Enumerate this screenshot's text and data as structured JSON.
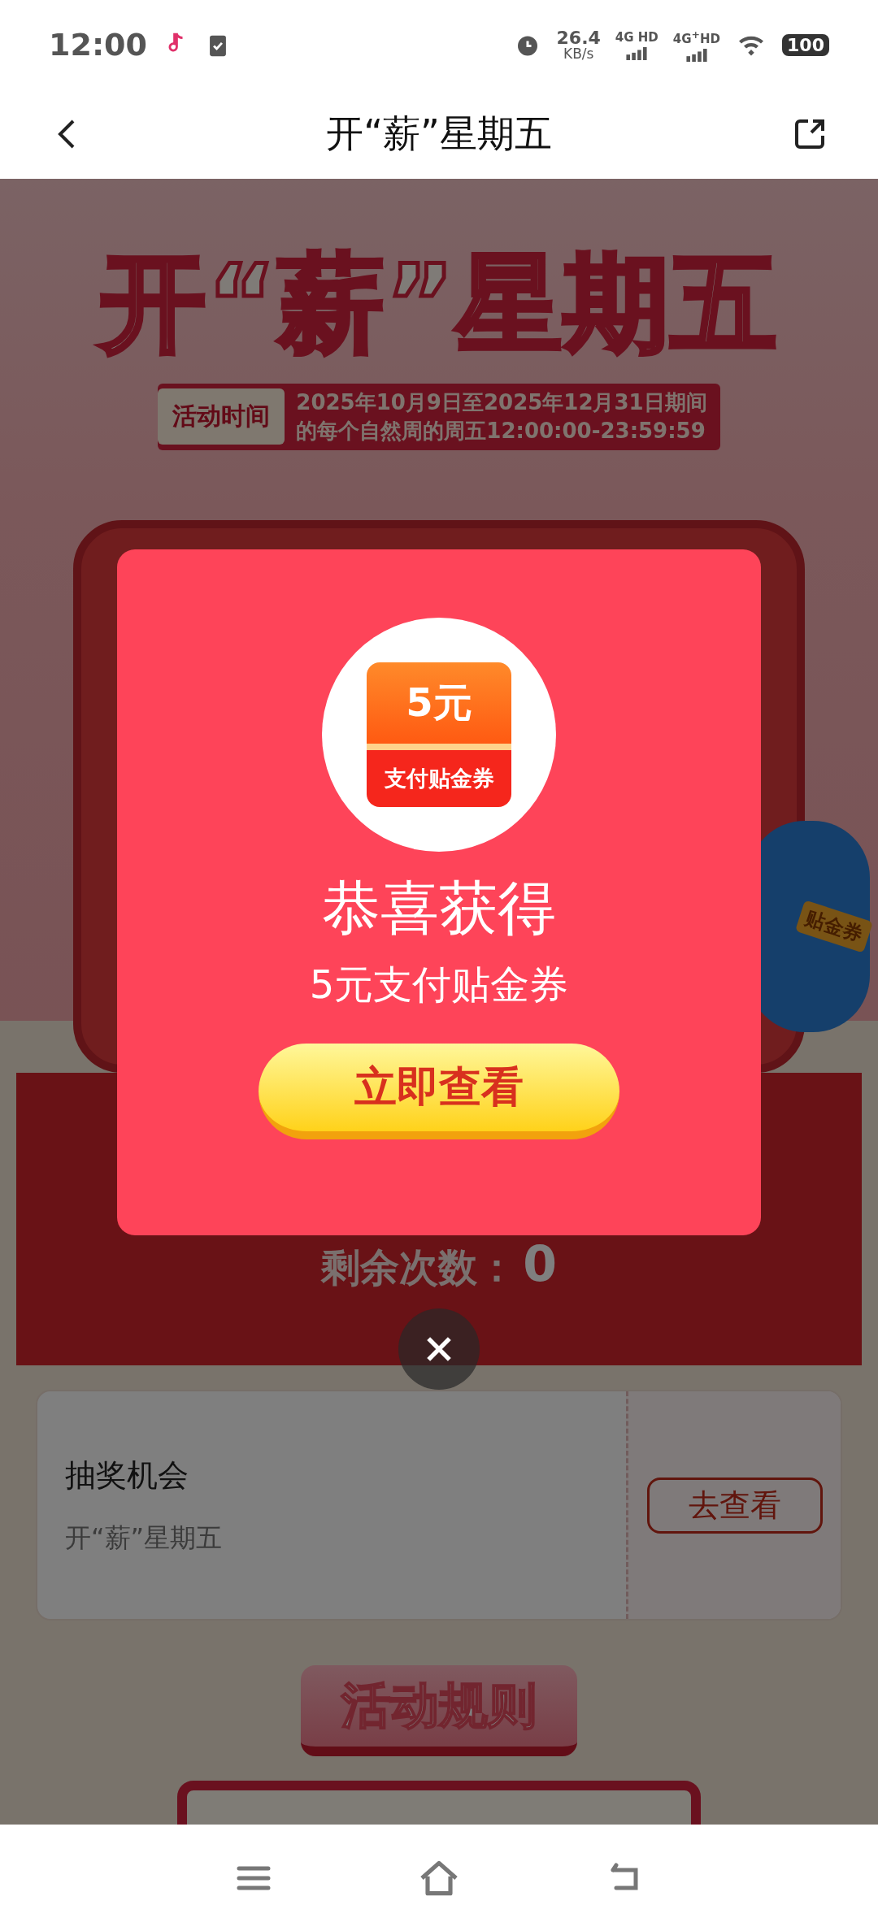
{
  "status_bar": {
    "time": "12:00",
    "speed_value": "26.4",
    "speed_unit": "KB/s",
    "sim_1": "4G HD",
    "sim_2": "4G$^{+}$HD",
    "battery": "100"
  },
  "nav": {
    "title": "开“薪”星期五"
  },
  "banner": {
    "title": "开“薪”星期五",
    "time_badge": "活动时间",
    "time_lines": [
      "2025年10月9日至2025年12月31日期间",
      "的每个自然周的周五12:00:00-23:59:59"
    ]
  },
  "machine": {
    "mascot_tag": "贴金券",
    "remaining_label": "剩余次数：",
    "remaining_value": "0"
  },
  "ticket": {
    "title": "抽奖机会",
    "subtitle": "开“薪”星期五",
    "button": "去查看"
  },
  "rules_button": "活动规则",
  "dialog": {
    "coupon_amount": "5元",
    "coupon_name": "支付贴金券",
    "heading": "恭喜获得",
    "prize": "5元支付贴金券",
    "button": "立即查看"
  }
}
